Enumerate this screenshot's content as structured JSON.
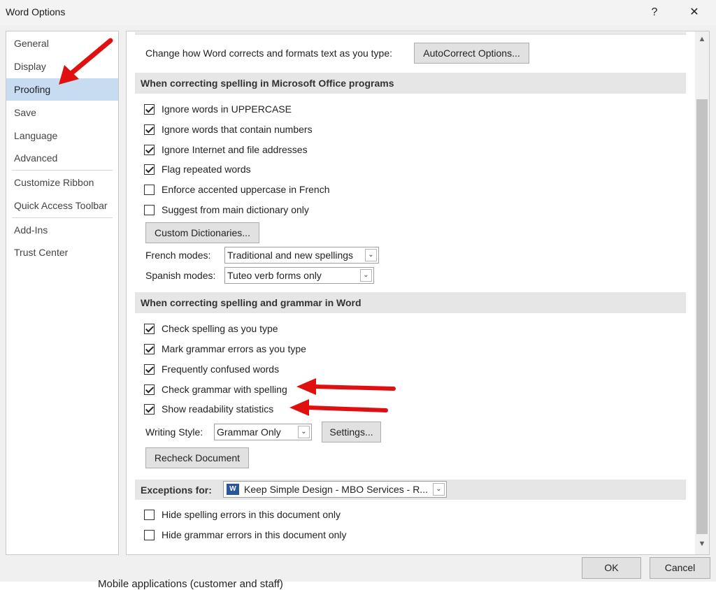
{
  "window": {
    "title": "Word Options",
    "help_label": "?",
    "close_label": "✕"
  },
  "sidebar": {
    "items": [
      {
        "label": "General"
      },
      {
        "label": "Display"
      },
      {
        "label": "Proofing"
      },
      {
        "label": "Save"
      },
      {
        "label": "Language"
      },
      {
        "label": "Advanced"
      },
      {
        "label": "Customize Ribbon"
      },
      {
        "label": "Quick Access Toolbar"
      },
      {
        "label": "Add-Ins"
      },
      {
        "label": "Trust Center"
      }
    ],
    "selected": "Proofing"
  },
  "autocorrect": {
    "text": "Change how Word corrects and formats text as you type:",
    "button": "AutoCorrect Options..."
  },
  "office_section": {
    "header": "When correcting spelling in Microsoft Office programs",
    "options": [
      {
        "label": "Ignore words in UPPERCASE",
        "checked": true
      },
      {
        "label": "Ignore words that contain numbers",
        "checked": true
      },
      {
        "label": "Ignore Internet and file addresses",
        "checked": true
      },
      {
        "label": "Flag repeated words",
        "checked": true
      },
      {
        "label": "Enforce accented uppercase in French",
        "checked": false
      },
      {
        "label": "Suggest from main dictionary only",
        "checked": false
      }
    ],
    "custom_dict_button": "Custom Dictionaries...",
    "french_label": "French modes:",
    "french_value": "Traditional and new spellings",
    "spanish_label": "Spanish modes:",
    "spanish_value": "Tuteo verb forms only"
  },
  "word_section": {
    "header": "When correcting spelling and grammar in Word",
    "options": [
      {
        "label": "Check spelling as you type",
        "checked": true
      },
      {
        "label": "Mark grammar errors as you type",
        "checked": true
      },
      {
        "label": "Frequently confused words",
        "checked": true
      },
      {
        "label": "Check grammar with spelling",
        "checked": true
      },
      {
        "label": "Show readability statistics",
        "checked": true
      }
    ],
    "writing_style_label": "Writing Style:",
    "writing_style_value": "Grammar Only",
    "settings_button": "Settings...",
    "recheck_button": "Recheck Document"
  },
  "exceptions": {
    "label": "Exceptions for:",
    "doc_icon": "W",
    "doc_value": "Keep Simple Design - MBO Services - R...",
    "options": [
      {
        "label": "Hide spelling errors in this document only",
        "checked": false
      },
      {
        "label": "Hide grammar errors in this document only",
        "checked": false
      }
    ]
  },
  "footer": {
    "ok": "OK",
    "cancel": "Cancel"
  },
  "background_text": "Mobile applications (customer and staff)",
  "icons": {
    "scroll_up": "▲",
    "scroll_down": "▼",
    "dropdown": "⌄"
  },
  "colors": {
    "selected_nav": "#c7dcf0",
    "section_header": "#e6e6e6",
    "annotation_arrow": "#e01010"
  }
}
